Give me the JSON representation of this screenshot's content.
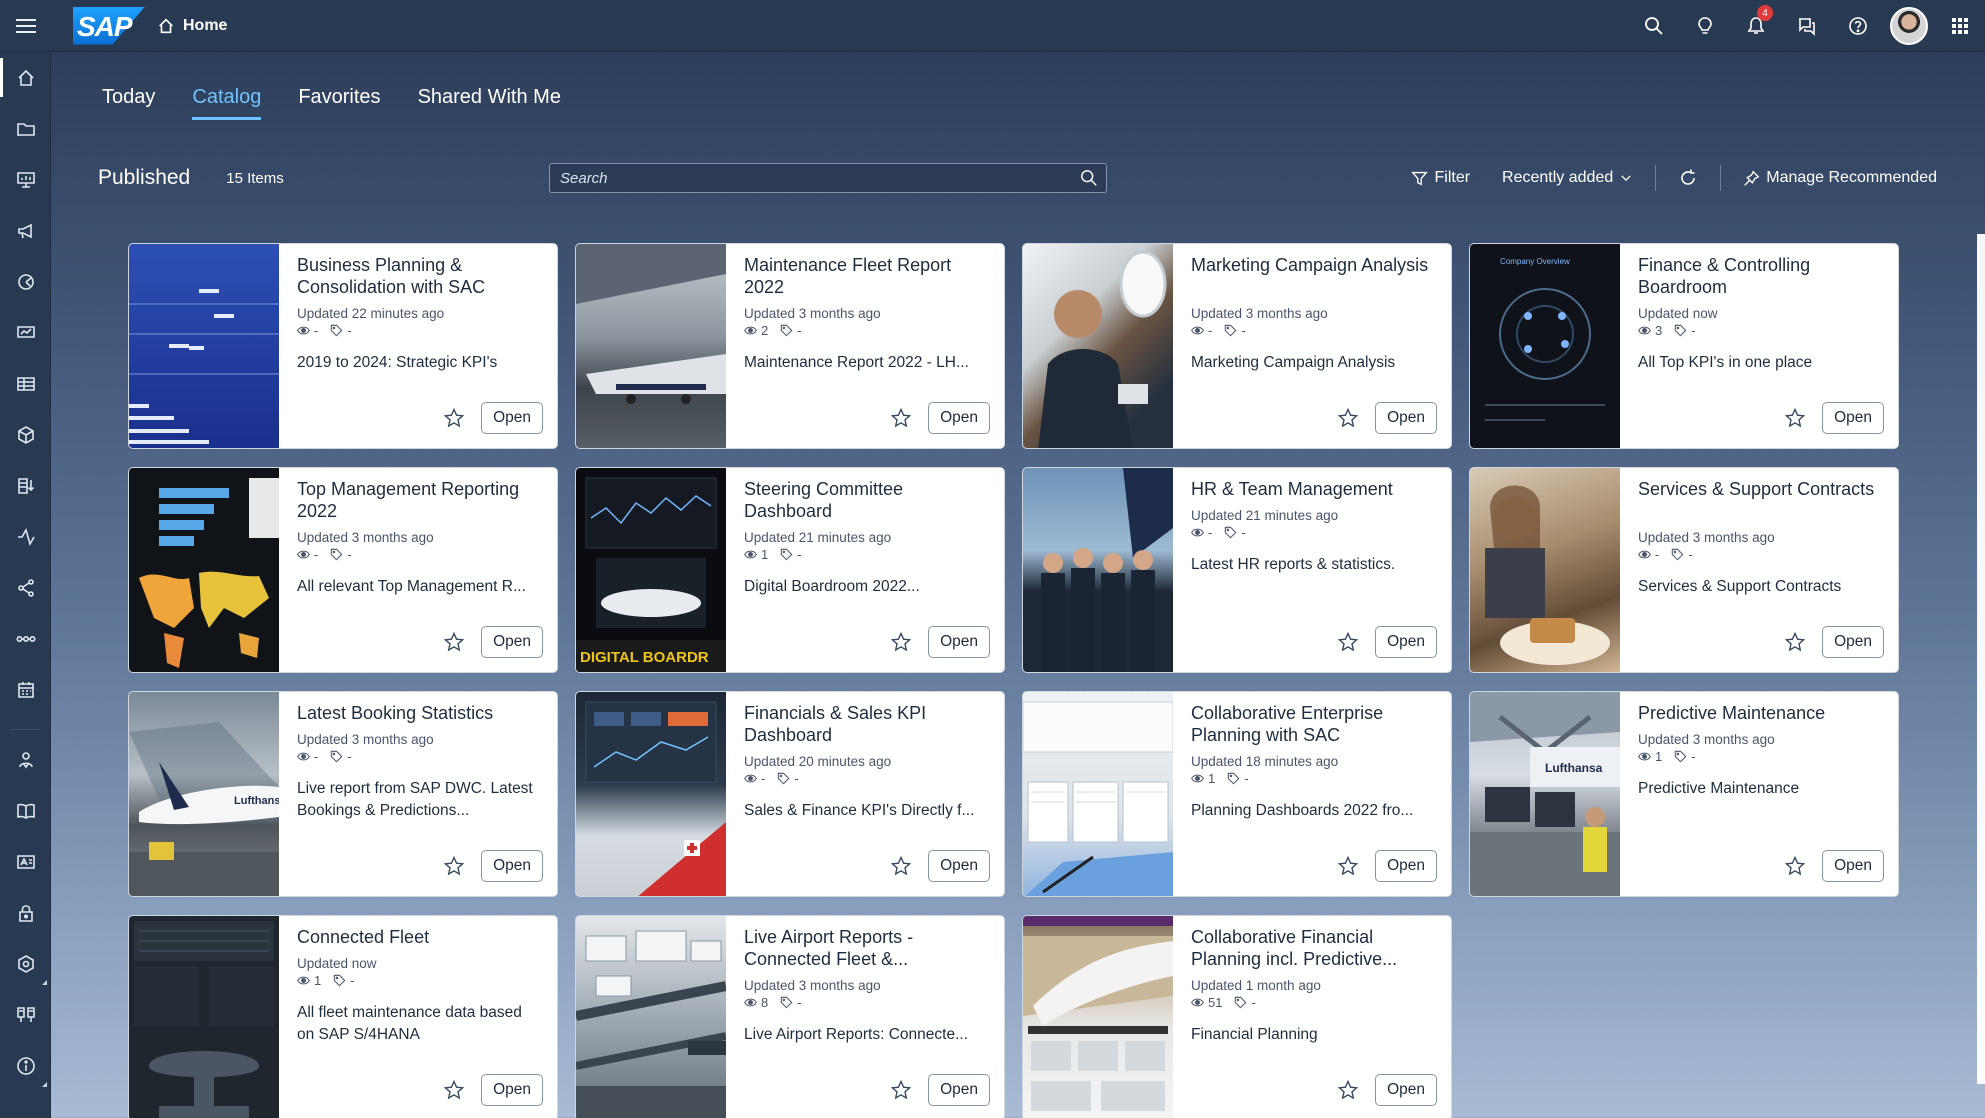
{
  "shell": {
    "home_label": "Home",
    "logo_text": "SAP",
    "notification_count": "4"
  },
  "tabs": [
    {
      "label": "Today"
    },
    {
      "label": "Catalog",
      "active": true
    },
    {
      "label": "Favorites"
    },
    {
      "label": "Shared With Me"
    }
  ],
  "toolbar": {
    "title": "Published",
    "count": "15 Items",
    "search_placeholder": "Search",
    "filter_label": "Filter",
    "sort_label": "Recently added",
    "manage_label": "Manage Recommended"
  },
  "cards": [
    {
      "title": "Business Planning & Consolidation with SAC",
      "updated": "Updated 22 minutes ago",
      "views": "-",
      "tags": "-",
      "desc": "2019 to 2024: Strategic KPI's",
      "open": "Open"
    },
    {
      "title": "Maintenance Fleet Report 2022",
      "updated": "Updated 3 months ago",
      "views": "2",
      "tags": "-",
      "desc": "Maintenance Report 2022 - LH...",
      "open": "Open"
    },
    {
      "title": "Marketing Campaign Analysis",
      "updated": "Updated 3 months ago",
      "views": "-",
      "tags": "-",
      "desc": "Marketing Campaign Analysis",
      "open": "Open"
    },
    {
      "title": "Finance & Controlling Boardroom",
      "updated": "Updated now",
      "views": "3",
      "tags": "-",
      "desc": "All Top KPI's in one place",
      "open": "Open"
    },
    {
      "title": "Top Management Reporting 2022",
      "updated": "Updated 3 months ago",
      "views": "-",
      "tags": "-",
      "desc": "All relevant Top Management R...",
      "open": "Open"
    },
    {
      "title": "Steering Committee Dashboard",
      "updated": "Updated 21 minutes ago",
      "views": "1",
      "tags": "-",
      "desc": "Digital Boardroom 2022...",
      "open": "Open"
    },
    {
      "title": "HR & Team Management",
      "updated": "Updated 21 minutes ago",
      "views": "-",
      "tags": "-",
      "desc": "Latest HR reports & statistics.",
      "open": "Open"
    },
    {
      "title": "Services & Support Contracts",
      "updated": "Updated 3 months ago",
      "views": "-",
      "tags": "-",
      "desc": "Services & Support Contracts",
      "open": "Open"
    },
    {
      "title": "Latest Booking Statistics",
      "updated": "Updated 3 months ago",
      "views": "-",
      "tags": "-",
      "desc": "Live report from SAP DWC. Latest Bookings & Predictions...",
      "open": "Open"
    },
    {
      "title": "Financials & Sales KPI Dashboard",
      "updated": "Updated 20 minutes ago",
      "views": "-",
      "tags": "-",
      "desc": "Sales & Finance KPI's Directly f...",
      "open": "Open"
    },
    {
      "title": "Collaborative Enterprise Planning with SAC",
      "updated": "Updated 18 minutes ago",
      "views": "1",
      "tags": "-",
      "desc": "Planning Dashboards 2022 fro...",
      "open": "Open"
    },
    {
      "title": "Predictive Maintenance",
      "updated": "Updated 3 months ago",
      "views": "1",
      "tags": "-",
      "desc": "Predictive Maintenance",
      "open": "Open"
    },
    {
      "title": "Connected Fleet",
      "updated": "Updated now",
      "views": "1",
      "tags": "-",
      "desc": "All fleet maintenance data based on SAP S/4HANA",
      "open": "Open"
    },
    {
      "title": "Live Airport Reports - Connected Fleet &...",
      "updated": "Updated 3 months ago",
      "views": "8",
      "tags": "-",
      "desc": "Live Airport Reports: Connecte...",
      "open": "Open"
    },
    {
      "title": "Collaborative Financial Planning incl. Predictive...",
      "updated": "Updated 1 month ago",
      "views": "51",
      "tags": "-",
      "desc": "Financial Planning",
      "open": "Open"
    }
  ],
  "thumb_text": {
    "steering": "DIGITAL BOARDR",
    "lufthansa": "Lufthansa",
    "finance_overview": "Company Overview"
  },
  "colors": {
    "shell": "#283a52",
    "accent": "#6fc3ff",
    "badge": "#e03a3a"
  }
}
